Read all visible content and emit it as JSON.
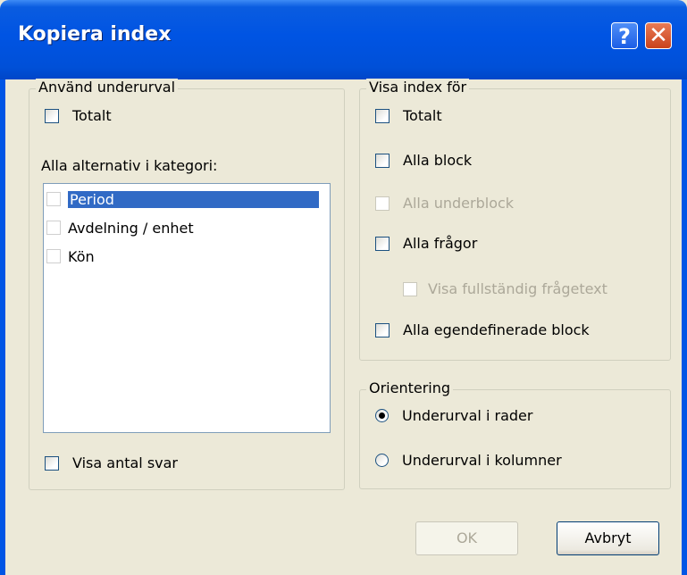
{
  "window": {
    "title": "Kopiera index",
    "help_icon": "help-icon",
    "close_icon": "close-icon",
    "help_glyph": "?",
    "close_glyph": "✕"
  },
  "subset_group": {
    "legend": "Använd underurval",
    "total_checkbox": {
      "label": "Totalt",
      "checked": false
    },
    "category_label": "Alla alternativ i kategori:",
    "list_items": [
      {
        "label": "Period",
        "checked": false,
        "selected": true
      },
      {
        "label": "Avdelning / enhet",
        "checked": false,
        "selected": false
      },
      {
        "label": "Kön",
        "checked": false,
        "selected": false
      }
    ],
    "show_count_checkbox": {
      "label": "Visa antal svar",
      "checked": false
    }
  },
  "show_index_group": {
    "legend": "Visa index för",
    "options": [
      {
        "label": "Totalt",
        "checked": false,
        "enabled": true
      },
      {
        "label": "Alla block",
        "checked": false,
        "enabled": true
      },
      {
        "label": "Alla underblock",
        "checked": false,
        "enabled": false
      },
      {
        "label": "Alla frågor",
        "checked": false,
        "enabled": true
      },
      {
        "label": "Visa fullständig frågetext",
        "checked": false,
        "enabled": false
      },
      {
        "label": "Alla egendefinerade block",
        "checked": false,
        "enabled": true
      }
    ]
  },
  "orientation_group": {
    "legend": "Orientering",
    "options": [
      {
        "label": "Underurval i rader",
        "selected": true
      },
      {
        "label": "Underurval i kolumner",
        "selected": false
      }
    ]
  },
  "buttons": {
    "ok": {
      "label": "OK",
      "enabled": false
    },
    "cancel": {
      "label": "Avbryt",
      "enabled": true
    }
  }
}
